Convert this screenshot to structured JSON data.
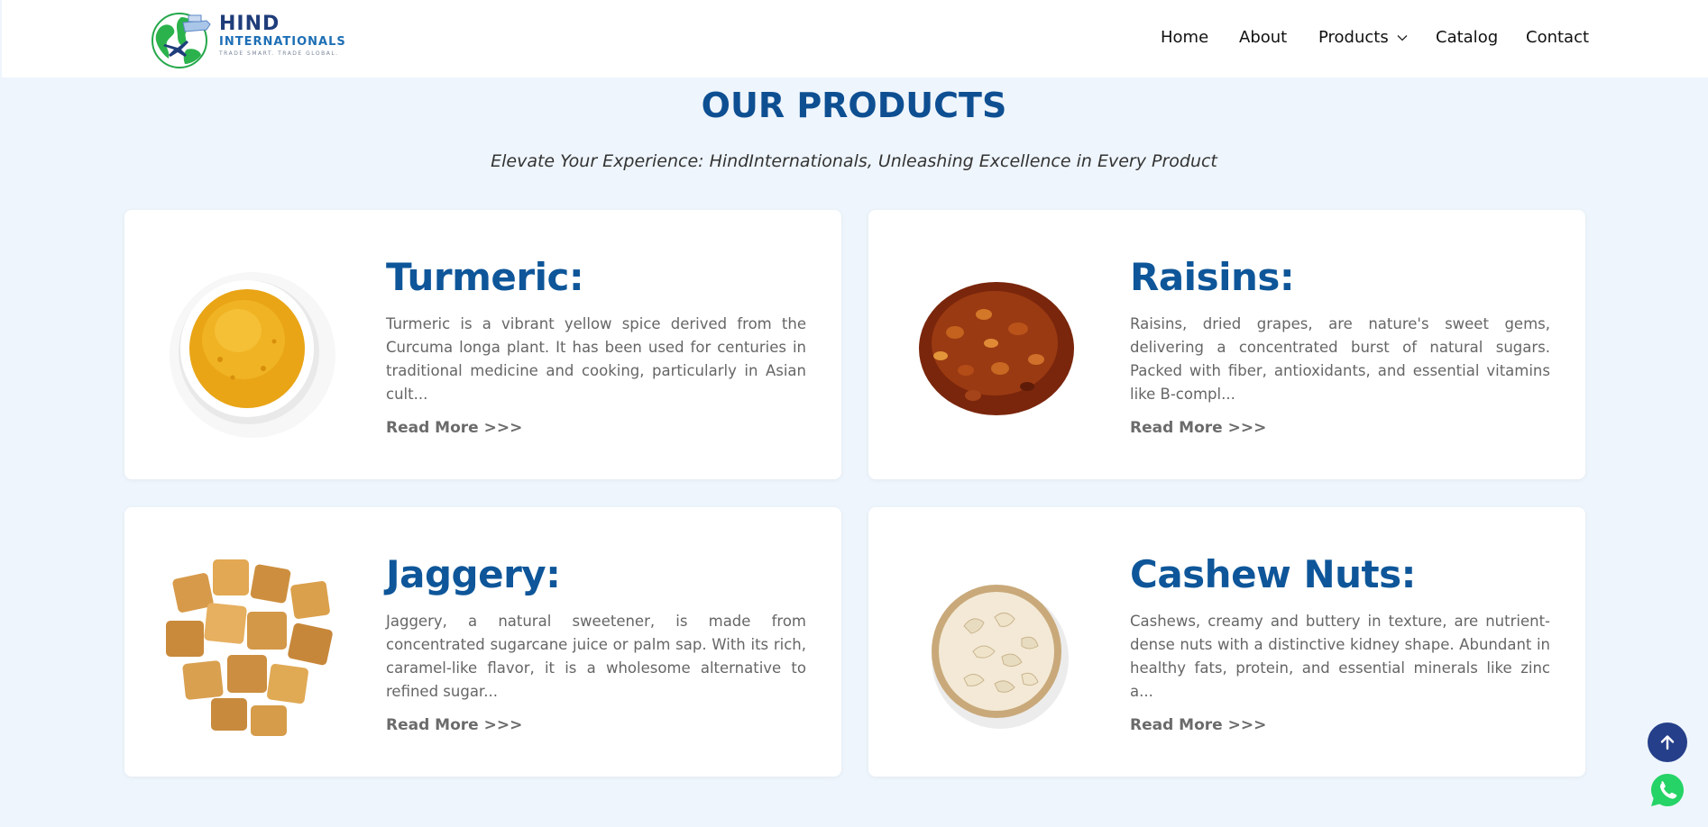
{
  "brand": {
    "name_line1": "HIND",
    "name_line2": "INTERNATIONALS",
    "tagline": "TRADE SMART. TRADE GLOBAL."
  },
  "nav": {
    "items": [
      {
        "label": "Home"
      },
      {
        "label": "About"
      },
      {
        "label": "Products"
      },
      {
        "label": "Catalog"
      },
      {
        "label": "Contact"
      }
    ]
  },
  "section": {
    "title": "OUR PRODUCTS",
    "subtitle": "Elevate Your Experience: HindInternationals, Unleashing Excellence in Every Product"
  },
  "products": [
    {
      "title": "Turmeric:",
      "description": "Turmeric is a vibrant yellow spice derived from the Curcuma longa plant. It has been used for centuries in traditional medicine and cooking, particularly in Asian cult...",
      "link": "Read More >>>"
    },
    {
      "title": "Raisins:",
      "description": "Raisins, dried grapes, are nature's sweet gems, delivering a concentrated burst of natural sugars. Packed with fiber, antioxidants, and essential vitamins like B-compl...",
      "link": "Read More >>>"
    },
    {
      "title": "Jaggery:",
      "description": "Jaggery, a natural sweetener, is made from concentrated sugarcane juice or palm sap. With its rich, caramel-like flavor, it is a wholesome alternative to refined sugar...",
      "link": "Read More >>>"
    },
    {
      "title": "Cashew Nuts:",
      "description": "Cashews, creamy and buttery in texture, are nutrient-dense nuts with a distinctive kidney shape. Abundant in healthy fats, protein, and essential minerals like zinc a...",
      "link": "Read More >>>"
    }
  ],
  "icons": {
    "scroll_top": "arrow-up-icon",
    "whatsapp": "whatsapp-icon",
    "logo": "globe-logo-icon"
  },
  "colors": {
    "background": "#eef5fc",
    "title": "#0e4f92",
    "card_title": "#0e5699",
    "scroll_top": "#253f8a",
    "whatsapp": "#25d366"
  }
}
